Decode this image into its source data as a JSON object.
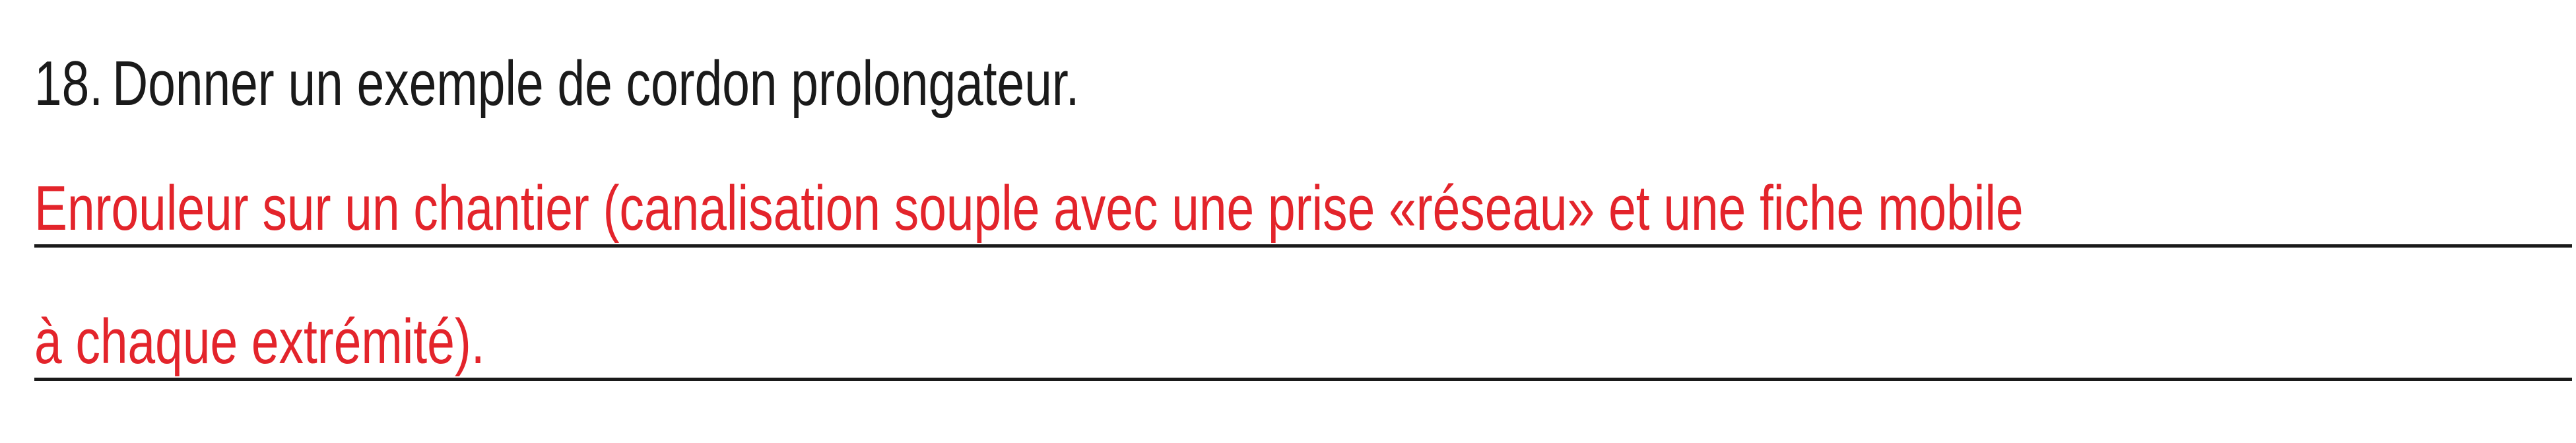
{
  "question": {
    "number": "18.",
    "text": "Donner un exemple de cordon prolongateur."
  },
  "answer": {
    "lines": [
      "Enrouleur sur un chantier (canalisation souple avec une prise «réseau» et une fiche mobile",
      "à chaque extrémité)."
    ],
    "color": "#e3242b"
  }
}
